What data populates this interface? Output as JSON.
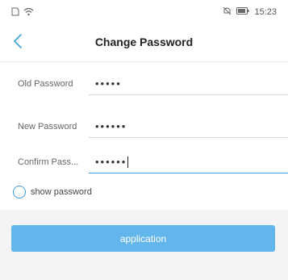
{
  "status_bar": {
    "left_icons": [
      "sim-icon",
      "wifi-icon"
    ],
    "right_icons": [
      "mute-icon",
      "battery-icon"
    ],
    "time": "15:23"
  },
  "nav": {
    "title": "Change Password"
  },
  "form": {
    "old_password": {
      "label": "Old Password",
      "value": "•••••"
    },
    "new_password": {
      "label": "New Password",
      "value": "••••••"
    },
    "confirm_password": {
      "label": "Confirm Pass...",
      "value": "••••••"
    },
    "show_password": {
      "label": "show password",
      "checked": false
    }
  },
  "actions": {
    "submit_label": "application"
  },
  "colors": {
    "accent": "#3ca0e0",
    "button": "#63b6ec",
    "background": "#f4f4f4"
  }
}
